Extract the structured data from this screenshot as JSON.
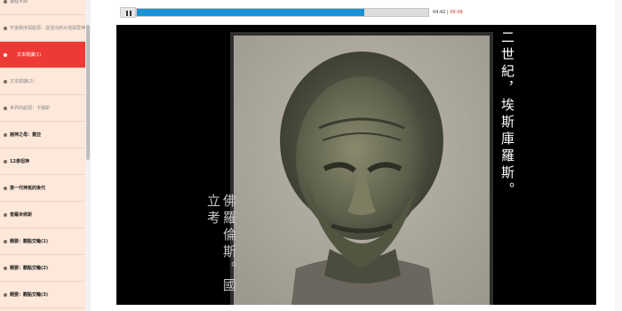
{
  "sidebar": {
    "items": [
      {
        "label": "課程大綱",
        "style": "muted"
      },
      {
        "label": "宇宙秩序與起源：從混沌到大地與眾神",
        "style": "muted"
      },
      {
        "label": "文本閱讀(1)",
        "style": "active"
      },
      {
        "label": "文本閱讀(2)",
        "style": "muted"
      },
      {
        "label": "世界的起源：卡俄斯",
        "style": "muted"
      },
      {
        "label": "諸神之母：蓋亞",
        "style": "bold"
      },
      {
        "label": "12泰坦神",
        "style": "bold"
      },
      {
        "label": "第一代神祇的後代",
        "style": "bold"
      },
      {
        "label": "普羅米修斯",
        "style": "bold"
      },
      {
        "label": "題要：觀點交輪(1)",
        "style": "bold"
      },
      {
        "label": "題要：觀點交輪(2)",
        "style": "bold"
      },
      {
        "label": "題要：觀點交輪(3)",
        "style": "bold"
      }
    ]
  },
  "player": {
    "progress": 0.78,
    "time_current": "04:42",
    "time_separator": "|",
    "time_total": "06:08",
    "pause_icon": "pause-icon"
  },
  "video": {
    "caption_right": "二世紀，埃斯庫羅斯。",
    "caption_left": "佛羅倫斯。國立考"
  },
  "colors": {
    "sidebar_bg": "#fde8da",
    "active_item": "#ee3a36",
    "progress_fill": "#1793d6",
    "time_total": "#c0392b"
  }
}
